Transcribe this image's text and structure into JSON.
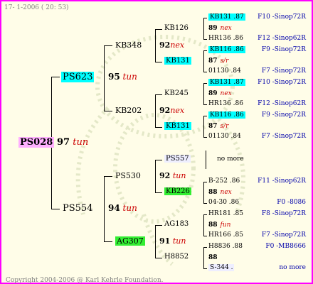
{
  "header": "17-  1-2006 ( 20: 53)",
  "footer": "Copyright 2004-2006 @ Karl Kehrle Foundation.",
  "root": {
    "id": "PS028",
    "num": "97",
    "tag": "tun"
  },
  "g1": [
    {
      "id": "PS623",
      "num": "95",
      "tag": "tun"
    },
    {
      "id": "PS554",
      "num": "94",
      "tag": "tun"
    }
  ],
  "g2": [
    {
      "id": "KB348",
      "num": "92",
      "tag": "nex"
    },
    {
      "id": "KB202",
      "num": "92",
      "tag": "nex"
    },
    {
      "id": "PS530",
      "num": "92",
      "tag": "tun"
    },
    {
      "id": "AG307",
      "num": "91",
      "tag": "tun"
    }
  ],
  "g3": [
    {
      "id": "KB126"
    },
    {
      "id": "KB131"
    },
    {
      "id": "KB245"
    },
    {
      "id": "KB131"
    },
    {
      "id": "PS557"
    },
    {
      "id": "KB226"
    },
    {
      "id": "AG183"
    },
    {
      "id": "H8852"
    }
  ],
  "g4": [
    {
      "id": "KB131 .87",
      "right": "F10 -Sinop72R"
    },
    {
      "id": "89",
      "tag": "nex",
      "right": ""
    },
    {
      "id": "HR136 .86",
      "right": "F12 -Sinop62R"
    },
    {
      "id": "KB116 .86",
      "right": "F9 -Sinop72R"
    },
    {
      "id": "87",
      "tag": "s/r",
      "right": ""
    },
    {
      "id": "01130 .84",
      "right": "F7 -Sinop72R"
    },
    {
      "id": "KB131 .87",
      "right": "F10 -Sinop72R"
    },
    {
      "id": "89",
      "tag": "nex",
      "right": ""
    },
    {
      "id": "HR136 .86",
      "right": "F12 -Sinop62R"
    },
    {
      "id": "KB116 .86",
      "right": "F9 -Sinop72R"
    },
    {
      "id": "87",
      "tag": "s/r",
      "right": ""
    },
    {
      "id": "01130 .84",
      "right": "F7 -Sinop72R"
    },
    {
      "id": "no more",
      "right": ""
    },
    {
      "id": "B-252 .86",
      "right": "F11 -Sinop62R"
    },
    {
      "id": "88",
      "tag": "nex",
      "right": ""
    },
    {
      "id": "04-30 .86",
      "right": "F0 -8086"
    },
    {
      "id": "HR181 .85",
      "right": "F8 -Sinop72R"
    },
    {
      "id": "88",
      "tag": "fun",
      "right": ""
    },
    {
      "id": "HR166 .85",
      "right": "F7 -Sinop72R"
    },
    {
      "id": "H8836 .88",
      "right": "F0 -MB8666"
    },
    {
      "id": "88",
      "tag": "",
      "right": ""
    },
    {
      "id": "S-344 .",
      "right": "no more"
    }
  ]
}
